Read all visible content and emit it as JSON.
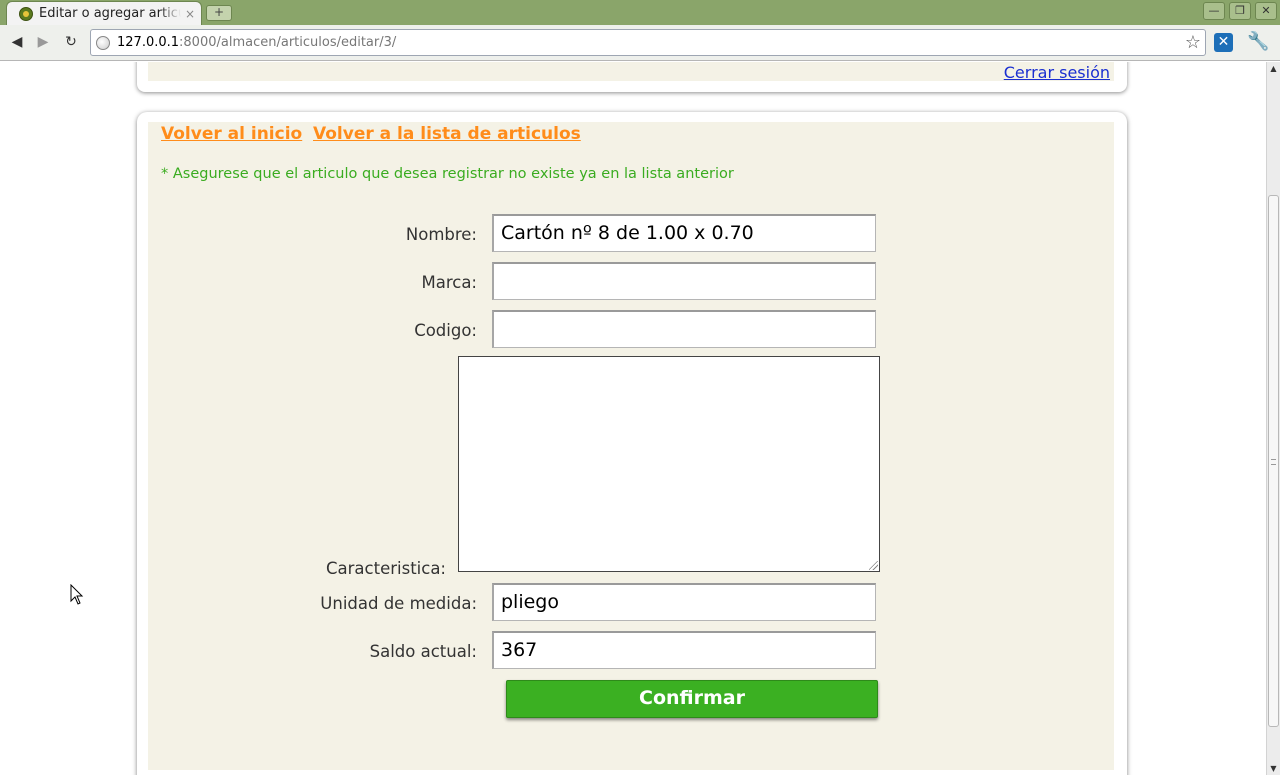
{
  "browser": {
    "tab_title": "Editar o agregar articulo",
    "tab_close": "×",
    "new_tab": "+",
    "window_controls": {
      "minimize": "—",
      "restore": "❐",
      "close": "✕"
    },
    "nav": {
      "back": "◀",
      "forward": "▶",
      "reload": "↻"
    },
    "url_host": "127.0.0.1",
    "url_rest": ":8000/almacen/articulos/editar/3/",
    "bookmark_icon": "☆",
    "extension_icon": "✕",
    "menu_icon": "🔧"
  },
  "header": {
    "logout": "Cerrar sesión"
  },
  "nav_links": {
    "home": "Volver al inicio",
    "list": "Volver a la lista de articulos"
  },
  "note": "* Asegurese que el articulo que desea registrar no existe ya en la lista anterior",
  "form": {
    "nombre_label": "Nombre:",
    "nombre_value": "Cartón nº 8 de 1.00 x 0.70",
    "marca_label": "Marca:",
    "marca_value": "",
    "codigo_label": "Codigo:",
    "codigo_value": "",
    "caracteristica_label": "Caracteristica:",
    "caracteristica_value": "",
    "unidad_label": "Unidad de medida:",
    "unidad_value": "pliego",
    "saldo_label": "Saldo actual:",
    "saldo_value": "367",
    "submit_label": "Confirmar"
  },
  "colors": {
    "panel_bg": "#f4f2e6",
    "link_orange": "#ff8c1a",
    "note_green": "#3aac20",
    "button_green": "#3bb022",
    "logout_blue": "#1a2fd1"
  }
}
